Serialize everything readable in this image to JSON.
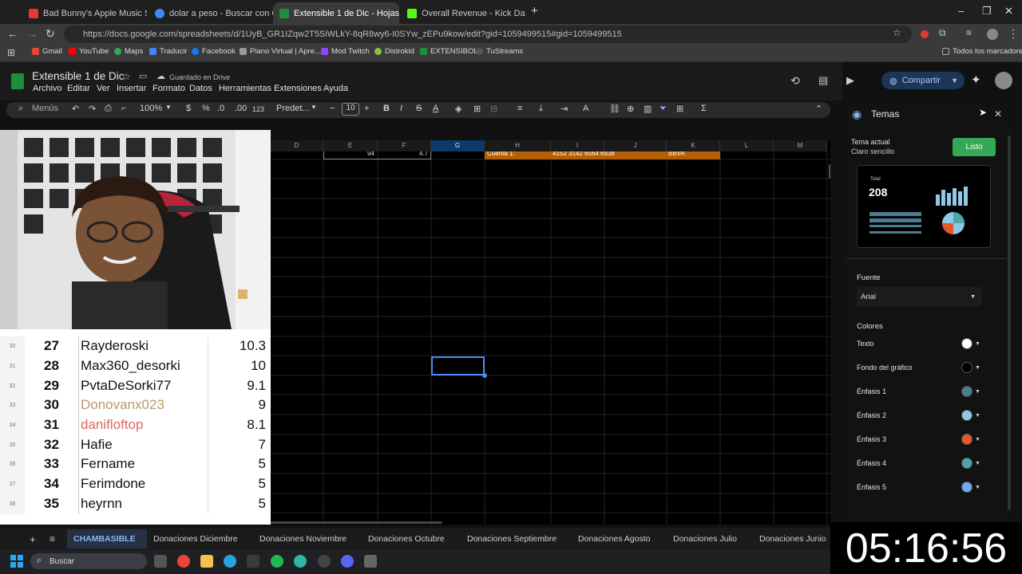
{
  "browser": {
    "tabs": [
      {
        "label": "Bad Bunny's Apple Music Super",
        "color": "#e53935"
      },
      {
        "label": "dolar a peso - Buscar con Goog",
        "color": "#4285f4"
      },
      {
        "label": "Extensible 1 de Dic - Hojas de c",
        "color": "#1e8e3e",
        "active": true
      },
      {
        "label": "Overall Revenue - Kick Dashboa",
        "color": "#53fc18"
      }
    ],
    "url": "https://docs.google.com/spreadsheets/d/1UyB_GR1IZqw2T5SiWLkY-8qR8wy6-I0SYw_zEPu9kow/edit?gid=1059499515#gid=1059499515",
    "bookmarks": [
      "Gmail",
      "YouTube",
      "Maps",
      "Traducir",
      "Facebook",
      "Piano Virtual | Apre...",
      "Mod Twitch",
      "Distrokid",
      "EXTENSIBOL",
      "TuStreams"
    ],
    "all_bookmarks": "Todos los marcadores"
  },
  "sheet": {
    "title": "Extensible 1 de Dic",
    "saved": "Guardado en Drive",
    "menus": [
      "Archivo",
      "Editar",
      "Ver",
      "Insertar",
      "Formato",
      "Datos",
      "Herramientas",
      "Extensiones",
      "Ayuda"
    ],
    "share": "Compartir",
    "toolbar": {
      "search": "Menús",
      "zoom": "100%",
      "font": "Predet...",
      "size": "10",
      "currency": "$",
      "percent": "%",
      "dec_less": ".0",
      "dec_more": ".00",
      "number": "123"
    },
    "columns": [
      "D",
      "E",
      "F",
      "G",
      "H",
      "I",
      "J",
      "K",
      "L",
      "M"
    ],
    "row_values": {
      "e": "94",
      "f": "4.7",
      "h": "Cuenta 1:",
      "i": "4152 3142 6564 6938",
      "k": "BBVA"
    },
    "tabs": [
      "CHAMBASIBLE",
      "Donaciones Diciembre",
      "Donaciones Noviembre",
      "Donaciones Octubre",
      "Donaciones Septiembre",
      "Donaciones Agosto",
      "Donaciones Julio",
      "Donaciones Junio"
    ]
  },
  "board": {
    "rows": [
      {
        "row": "30",
        "rank": "27",
        "name": "Rayderoski",
        "amount": "10.3",
        "color": "#111111"
      },
      {
        "row": "31",
        "rank": "28",
        "name": "Max360_desorki",
        "amount": "10",
        "color": "#111111"
      },
      {
        "row": "32",
        "rank": "29",
        "name": "PvtaDeSorki77",
        "amount": "9.1",
        "color": "#111111"
      },
      {
        "row": "33",
        "rank": "30",
        "name": "Donovanx023",
        "amount": "9",
        "color": "#b8986a"
      },
      {
        "row": "34",
        "rank": "31",
        "name": "danifloftop",
        "amount": "8.1",
        "color": "#e06666"
      },
      {
        "row": "35",
        "rank": "32",
        "name": "Hafie",
        "amount": "7",
        "color": "#111111"
      },
      {
        "row": "36",
        "rank": "33",
        "name": "Fername",
        "amount": "5",
        "color": "#111111"
      },
      {
        "row": "37",
        "rank": "34",
        "name": "Ferimdone",
        "amount": "5",
        "color": "#111111"
      },
      {
        "row": "38",
        "rank": "35",
        "name": "heyrnn",
        "amount": "5",
        "color": "#111111"
      }
    ]
  },
  "panel": {
    "title": "Temas",
    "current_label": "Tema actual",
    "current_value": "Claro sencillo",
    "done": "Listo",
    "preview_label": "Total",
    "preview_value": "208",
    "font_label": "Fuente",
    "font_value": "Arial",
    "colors_label": "Colores",
    "colors": [
      {
        "label": "Texto",
        "hex": "#ffffff"
      },
      {
        "label": "Fondo del gráfico",
        "hex": "#000000"
      },
      {
        "label": "Énfasis 1",
        "hex": "#4a7c94"
      },
      {
        "label": "Énfasis 2",
        "hex": "#8ecae6"
      },
      {
        "label": "Énfasis 3",
        "hex": "#e8572a"
      },
      {
        "label": "Énfasis 4",
        "hex": "#4fa6a8"
      },
      {
        "label": "Énfasis 5",
        "hex": "#6fa8f5"
      }
    ]
  },
  "clock": "05:16:56",
  "taskbar": {
    "search": "Buscar"
  }
}
